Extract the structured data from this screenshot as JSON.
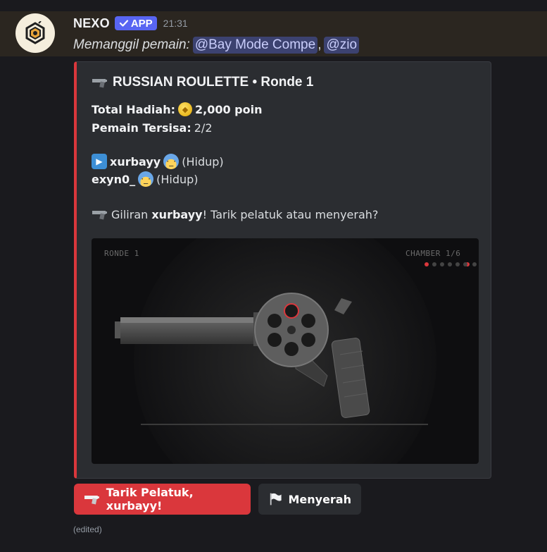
{
  "message": {
    "username": "NEXO",
    "badge": "APP",
    "timestamp": "21:31",
    "content_prefix": "Memanggil pemain:",
    "mentions": [
      "@Bay Mode Compe",
      "@zio"
    ],
    "separator": ",",
    "edited": "(edited)"
  },
  "embed": {
    "accent_color": "#da373c",
    "title": "RUSSIAN ROULETTE • Ronde 1",
    "prize_label": "Total Hadiah:",
    "prize_value": "2,000 poin",
    "remaining_label": "Pemain Tersisa:",
    "remaining_value": "2/2",
    "players": [
      {
        "name": "xurbayy",
        "status": "(Hidup)",
        "current": true
      },
      {
        "name": "exyn0_",
        "status": "(Hidup)",
        "current": false
      }
    ],
    "turn_prefix": "Giliran",
    "turn_player": "xurbayy",
    "turn_suffix": "! Tarik pelatuk atau menyerah?",
    "image": {
      "round_label": "RONDE 1",
      "chamber_label": "CHAMBER 1/6",
      "chamber_dots": 6,
      "active_dot": 1
    }
  },
  "buttons": {
    "pull": "Tarik Pelatuk, xurbayy!",
    "surrender": "Menyerah"
  },
  "colors": {
    "brand": "#5865f2",
    "danger": "#da373c",
    "mention_bg": "#3c4270"
  }
}
